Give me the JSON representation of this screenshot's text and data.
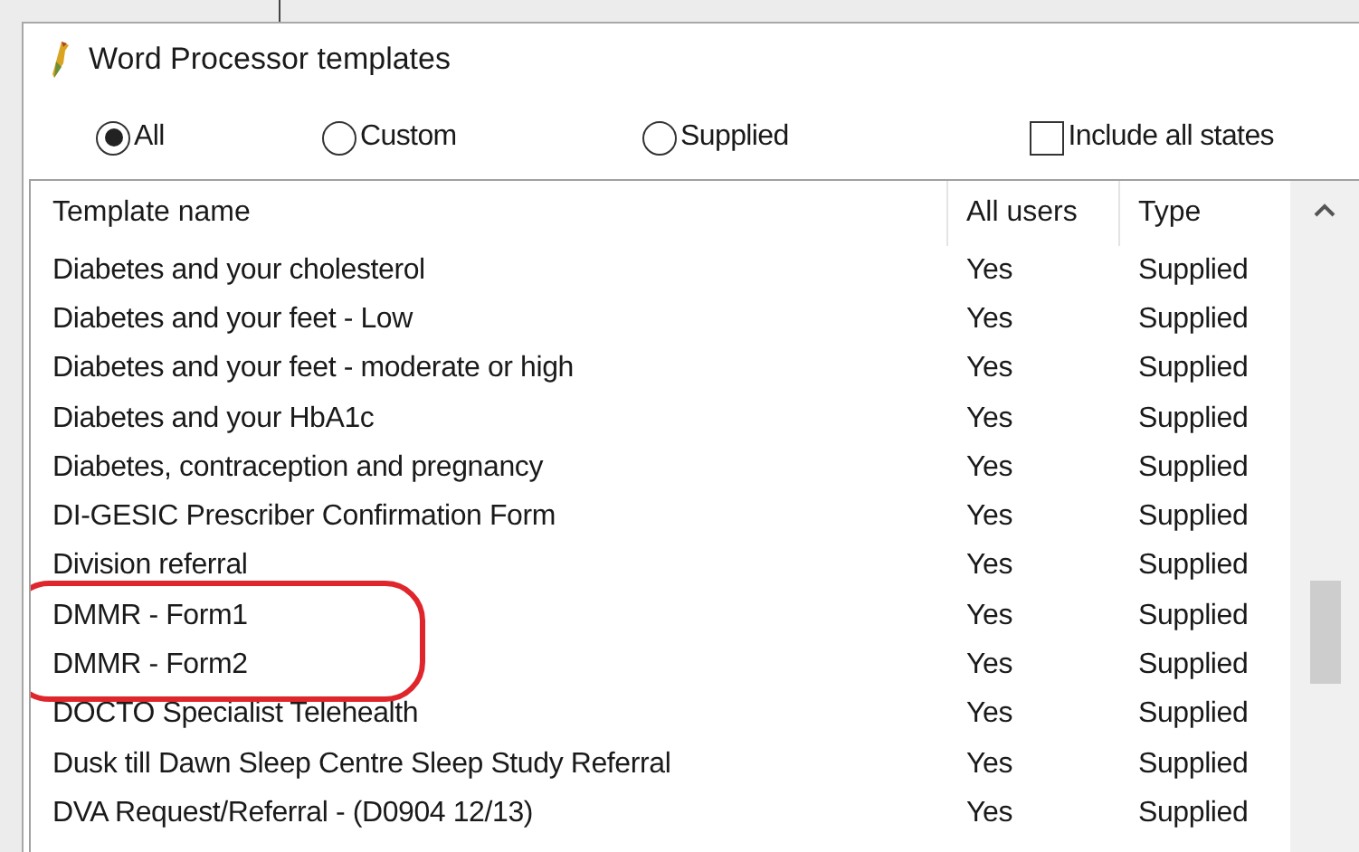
{
  "window": {
    "title": "Word Processor templates"
  },
  "filter": [
    {
      "label": "All",
      "selected": true
    },
    {
      "label": "Custom",
      "selected": false
    },
    {
      "label": "Supplied",
      "selected": false
    }
  ],
  "include_all_states": {
    "label": "Include all states",
    "checked": false
  },
  "table": {
    "columns": [
      "Template name",
      "All users",
      "Type"
    ],
    "rows": [
      {
        "name": "Diabetes and your cholesterol",
        "all_users": "Yes",
        "type": "Supplied",
        "circled": false
      },
      {
        "name": "Diabetes and your feet - Low",
        "all_users": "Yes",
        "type": "Supplied",
        "circled": false
      },
      {
        "name": "Diabetes and your feet - moderate or high",
        "all_users": "Yes",
        "type": "Supplied",
        "circled": false
      },
      {
        "name": "Diabetes and your HbA1c",
        "all_users": "Yes",
        "type": "Supplied",
        "circled": false
      },
      {
        "name": "Diabetes, contraception and pregnancy",
        "all_users": "Yes",
        "type": "Supplied",
        "circled": false
      },
      {
        "name": "DI-GESIC Prescriber Confirmation Form",
        "all_users": "Yes",
        "type": "Supplied",
        "circled": false
      },
      {
        "name": "Division referral",
        "all_users": "Yes",
        "type": "Supplied",
        "circled": false
      },
      {
        "name": "DMMR - Form1",
        "all_users": "Yes",
        "type": "Supplied",
        "circled": true
      },
      {
        "name": "DMMR - Form2",
        "all_users": "Yes",
        "type": "Supplied",
        "circled": true
      },
      {
        "name": "DOCTO Specialist Telehealth",
        "all_users": "Yes",
        "type": "Supplied",
        "circled": false
      },
      {
        "name": "Dusk till Dawn Sleep Centre Sleep Study Referral",
        "all_users": "Yes",
        "type": "Supplied",
        "circled": false
      },
      {
        "name": "DVA Request/Referral - (D0904 12/13)",
        "all_users": "Yes",
        "type": "Supplied",
        "circled": false
      }
    ]
  }
}
